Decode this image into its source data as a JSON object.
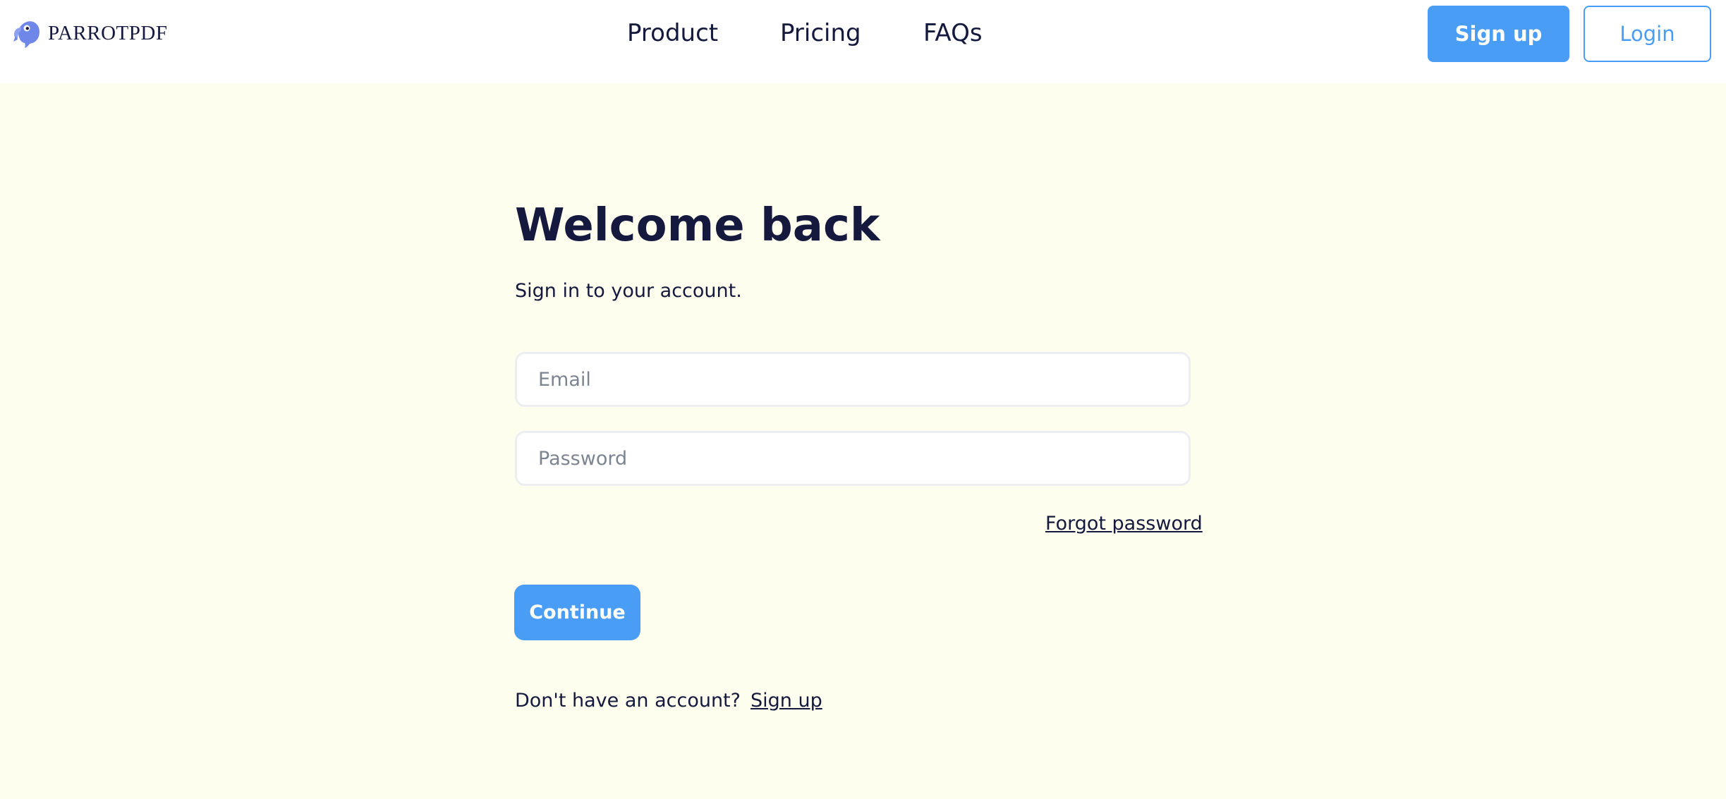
{
  "brand": {
    "name": "PARROTPDF",
    "icon": "parrot-logo-icon"
  },
  "nav": {
    "items": [
      "Product",
      "Pricing",
      "FAQs"
    ]
  },
  "header": {
    "signup_label": "Sign up",
    "login_label": "Login"
  },
  "form": {
    "title": "Welcome back",
    "subtitle": "Sign in to your account.",
    "email_placeholder": "Email",
    "email_value": "",
    "password_placeholder": "Password",
    "password_value": "",
    "forgot_label": "Forgot password",
    "continue_label": "Continue",
    "no_account_text": "Don't have an account?",
    "signup_link_label": "Sign up"
  },
  "colors": {
    "accent": "#4a9df5",
    "text": "#14193d",
    "page_background": "#fefeef",
    "header_background": "#ffffff",
    "logo": "#6f87e8"
  }
}
